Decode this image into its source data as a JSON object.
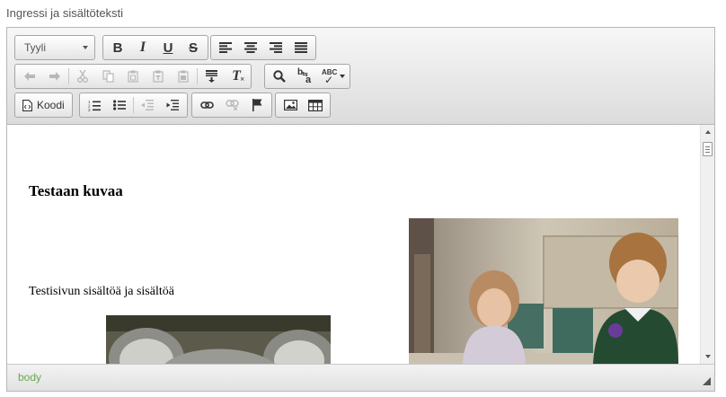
{
  "field_label": "Ingressi ja sisältöteksti",
  "toolbar": {
    "style_combo": {
      "value": "Tyyli"
    },
    "bold": "B",
    "italic": "I",
    "underline": "U",
    "strike": "S",
    "source_label": "Koodi",
    "spellcheck_text": "ABC",
    "replace_text": "b",
    "replace_sub": "a",
    "clear_format": "T"
  },
  "content": {
    "heading": "Testaan kuvaa",
    "paragraph": "Testisivun sisältöä ja sisältöä"
  },
  "status": {
    "element_path": "body"
  },
  "colors": {
    "path_text": "#6aa84f",
    "toolbar_top": "#f7f7f7",
    "toolbar_bottom": "#dcdcdc"
  }
}
